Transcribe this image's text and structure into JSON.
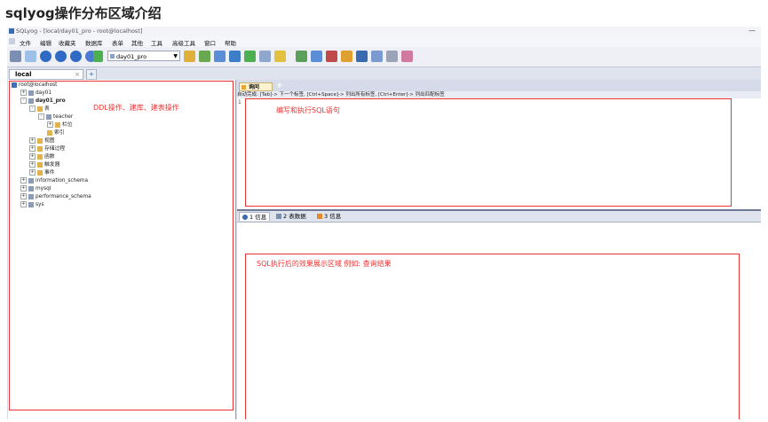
{
  "page_title": "sqlyog操作分布区域介绍",
  "window": {
    "title": "SQLyog - [local/day01_pro - root@localhost]",
    "minimize": "—"
  },
  "menu": [
    "文件",
    "编辑",
    "收藏夹",
    "数据库",
    "表单",
    "其他",
    "工具",
    "高级工具",
    "窗口",
    "帮助"
  ],
  "toolbar": {
    "db_selector": "day01_pro"
  },
  "connection_tab": {
    "label": "local",
    "close": "×",
    "add": "+"
  },
  "tree": [
    {
      "label": "root@localhost",
      "level": 0,
      "icon": "server",
      "toggle": ""
    },
    {
      "label": "day01",
      "level": 1,
      "icon": "db",
      "toggle": "+"
    },
    {
      "label": "day01_pro",
      "level": 1,
      "icon": "db",
      "toggle": "-",
      "bold": true
    },
    {
      "label": "表",
      "level": 2,
      "icon": "folder",
      "toggle": "-"
    },
    {
      "label": "teacher",
      "level": 3,
      "icon": "table",
      "toggle": "-"
    },
    {
      "label": "栏位",
      "level": 4,
      "icon": "folder",
      "toggle": "+"
    },
    {
      "label": "索引",
      "level": 4,
      "icon": "folder",
      "toggle": ""
    },
    {
      "label": "视图",
      "level": 2,
      "icon": "folder",
      "toggle": "+"
    },
    {
      "label": "存储过程",
      "level": 2,
      "icon": "folder",
      "toggle": "+"
    },
    {
      "label": "函数",
      "level": 2,
      "icon": "folder",
      "toggle": "+"
    },
    {
      "label": "触发器",
      "level": 2,
      "icon": "folder",
      "toggle": "+"
    },
    {
      "label": "事件",
      "level": 2,
      "icon": "folder",
      "toggle": "+"
    },
    {
      "label": "information_schema",
      "level": 1,
      "icon": "db",
      "toggle": "+"
    },
    {
      "label": "mysql",
      "level": 1,
      "icon": "db",
      "toggle": "+"
    },
    {
      "label": "performance_schema",
      "level": 1,
      "icon": "db",
      "toggle": "+"
    },
    {
      "label": "sys",
      "level": 1,
      "icon": "db",
      "toggle": "+"
    }
  ],
  "query_tab": {
    "label": "询问",
    "add": "+"
  },
  "hint_bar": "自动完成: [Tab]-> 下一个标签, [Ctrl+Space]-> 列出所有标签, [Ctrl+Enter]-> 列出匹配标签",
  "editor": {
    "line_number": "1"
  },
  "result_tabs": [
    {
      "label": "1 信息",
      "active": true,
      "color": "#3a6ab0"
    },
    {
      "label": "2 表数据",
      "active": false,
      "color": "#7a8fb0"
    },
    {
      "label": "3 信息",
      "active": false,
      "color": "#e08a2a"
    }
  ],
  "annotations": {
    "ddl": "DDL操作、建库、建表操作",
    "sql": "编写和执行SQL语句",
    "result": "SQL执行后的效果展示区域    例如: 查询结果",
    "color": "#e33333"
  }
}
